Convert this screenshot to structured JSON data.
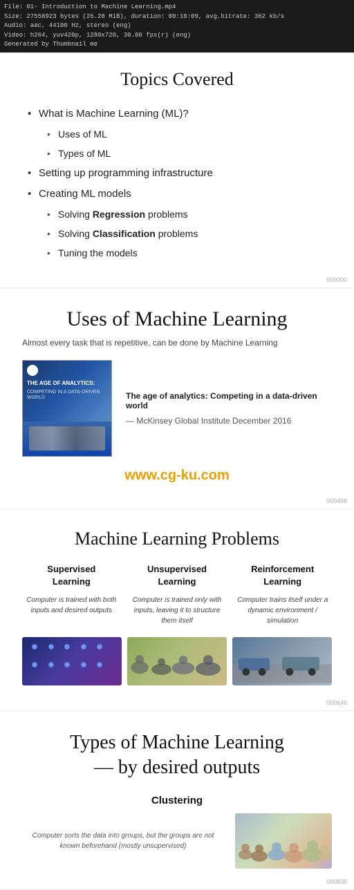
{
  "fileInfo": {
    "line1": "File: 01- Introduction to Machine Learning.mp4",
    "line2": "Size: 27558923 bytes (26.28 MiB), duration: 00:10:09, avg.bitrate: 362 kb/s",
    "line3": "Audio: aac, 44100 Hz, stereo (eng)",
    "line4": "Video: h264, yuv420p, 1280x720, 30.00 fps(r) (eng)",
    "line5": "Generated by Thumbnail me"
  },
  "slide1": {
    "title": "Topics Covered",
    "items": [
      {
        "text": "What is Machine Learning (ML)?",
        "level": 1
      },
      {
        "text": "Uses of ML",
        "level": 2
      },
      {
        "text": "Types of ML",
        "level": 2
      },
      {
        "text": "Setting up programming infrastructure",
        "level": 1
      },
      {
        "text": "Creating ML models",
        "level": 1
      },
      {
        "text": "Solving ",
        "bold": "Regression",
        "suffix": " problems",
        "level": 2
      },
      {
        "text": "Solving ",
        "bold": "Classification",
        "suffix": " problems",
        "level": 2
      },
      {
        "text": "Tuning the models",
        "level": 2
      }
    ],
    "slideNum": "000000"
  },
  "slide2": {
    "title": "Uses of Machine Learning",
    "subtitle": "Almost every task that is repetitive, can be done by Machine Learning",
    "bookTitle": "THE AGE OF ANALYTICS:",
    "bookSubtitle": "COMPETING IN A DATA-DRIVEN WORLD",
    "captionTitle": "The age of analytics: Competing in a data-driven world",
    "captionSource": "— McKinsey Global Institute December 2016",
    "watermark": "www.cg-ku.com",
    "slideNum": "000456"
  },
  "slide3": {
    "title": "Machine Learning Problems",
    "columns": [
      {
        "title": "Supervised Learning",
        "desc": "Computer is trained with both inputs and desired outputs"
      },
      {
        "title": "Unsupervised Learning",
        "desc": "Computer is trained only with inputs, leaving it to structure them itself"
      },
      {
        "title": "Reinforcement Learning",
        "desc": "Computer trains itself under a dynamic environment / simulation"
      }
    ],
    "slideNum": "000646"
  },
  "slide4": {
    "titleLine1": "Types of Machine Learning",
    "titleLine2": "— by desired outputs",
    "clusteringTitle": "Clustering",
    "clusteringDesc": "Computer sorts the data into groups, but the groups are not known beforehand (mostly unsupervised)",
    "slideNum": "000836"
  }
}
